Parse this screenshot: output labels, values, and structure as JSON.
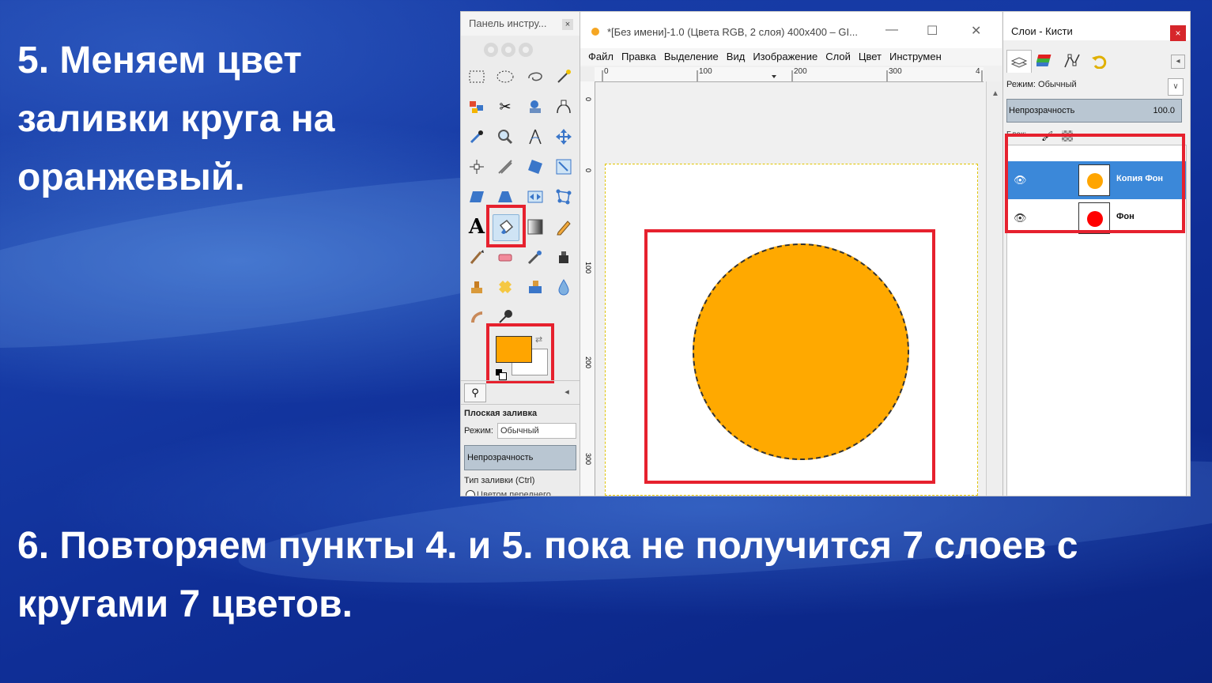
{
  "slide": {
    "step5_text": "5. Меняем цвет заливки круга на оранжевый.",
    "step6_text": "6. Повторяем пункты 4. и 5. пока не получится 7 слоев с кругами 7 цветов."
  },
  "toolbox": {
    "title": "Панель инстру...",
    "close": "×",
    "tool_options_title": "Плоская заливка",
    "mode_label": "Режим:",
    "mode_value": "Обычный",
    "opacity_label": "Непрозрачность",
    "fill_type_label": "Тип заливки (Ctrl)",
    "fill_type_option": "Цветом переднего",
    "fg_color": "#ffa500",
    "bg_color": "#ffffff"
  },
  "image_window": {
    "title": "*[Без имени]-1.0 (Цвета RGB, 2 слоя) 400x400 – GI...",
    "menu": [
      "Файл",
      "Правка",
      "Выделение",
      "Вид",
      "Изображение",
      "Слой",
      "Цвет",
      "Инструмен"
    ],
    "ruler_top": [
      "0",
      "100",
      "200",
      "300",
      "4"
    ],
    "ruler_left": [
      "0",
      "0",
      "100",
      "200",
      "300"
    ],
    "circle_color": "#ffa900"
  },
  "layers_panel": {
    "title": "Слои - Кисти",
    "close": "×",
    "mode_label": "Режим: Обычный",
    "opacity_label": "Непрозрачность",
    "opacity_value": "100.0",
    "lock_label": "Блок:",
    "layers": [
      {
        "name": "Копия Фон",
        "color": "#ffa500",
        "active": true
      },
      {
        "name": "Фон",
        "color": "#ff0000",
        "active": false
      }
    ]
  },
  "accent_colors": {
    "highlight_box": "#e6212e",
    "selection_blue": "#3b88d9"
  }
}
